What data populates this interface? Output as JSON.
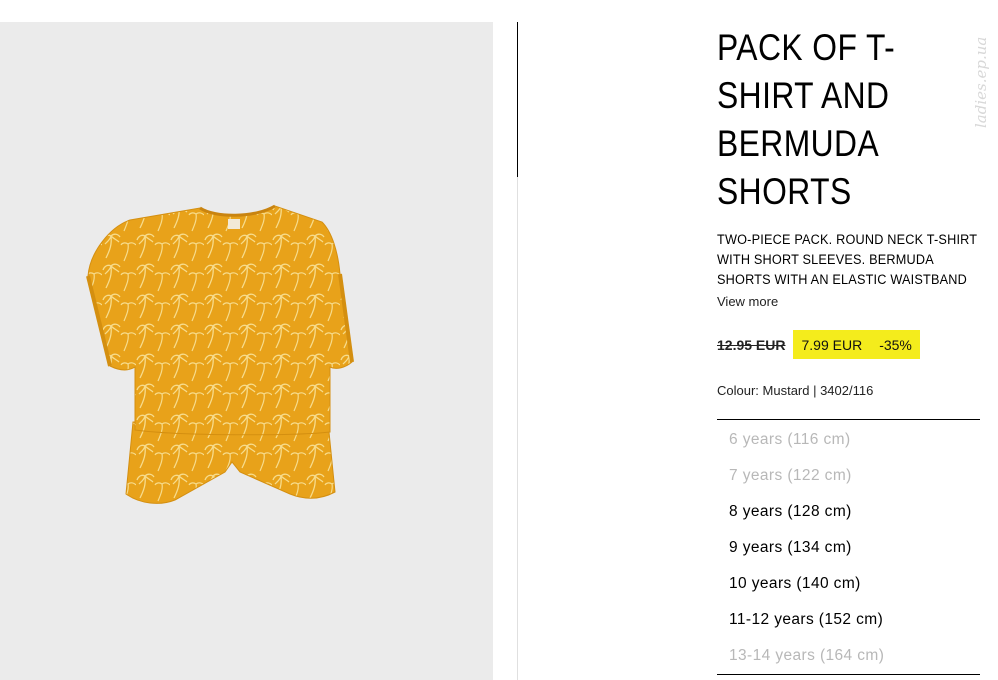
{
  "product": {
    "image_alt": "Mustard palm print t-shirt and bermuda shorts set",
    "title_lines": [
      "PACK OF T-",
      "SHIRT AND",
      "BERMUDA",
      "SHORTS"
    ],
    "description_lines": [
      "TWO-PIECE PACK. ROUND NECK T-SHIRT",
      "WITH SHORT SLEEVES. BERMUDA",
      "SHORTS WITH AN ELASTIC WAISTBAND"
    ],
    "view_more": "View more",
    "old_price": "12.95 EUR",
    "new_price": "7.99 EUR",
    "discount": "-35%",
    "colour": "Colour: Mustard | 3402/116"
  },
  "sizes": [
    {
      "label": "6 years (116 cm)",
      "available": false
    },
    {
      "label": "7 years (122 cm)",
      "available": false
    },
    {
      "label": "8 years (128 cm)",
      "available": true
    },
    {
      "label": "9 years (134 cm)",
      "available": true
    },
    {
      "label": "10 years (140 cm)",
      "available": true
    },
    {
      "label": "11-12 years (152 cm)",
      "available": true
    },
    {
      "label": "13-14 years (164 cm)",
      "available": false
    }
  ],
  "watermark": "ladies.ep.ua",
  "colors": {
    "sale_highlight": "#f4ec1c",
    "garment": "#e8a21a",
    "image_background": "#ebebeb",
    "unavailable_text": "#b8b8b8"
  }
}
